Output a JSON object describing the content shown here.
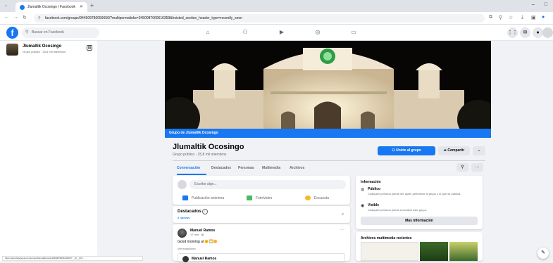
{
  "browser": {
    "tab_title": "Jlumaltik Ocosingo | Facebook",
    "url": "facebook.com/groups/944509780059650/?multipermalinks=3450087060610359&hoisted_section_header_type=recently_seen",
    "status_url": "https://www.facebook.com/groups/Jlumaltik/posts/3450087060610359/?__cft__[0]=..."
  },
  "fb": {
    "search_placeholder": "Buscar en Facebook"
  },
  "sidebar": {
    "group_name": "Jlumaltik Ocosingo",
    "group_meta": "Grupo público · 25,8 mil miembros"
  },
  "cover": {
    "label": "Grupo de Jlumaltik Ocosingo"
  },
  "group": {
    "title": "Jlumaltik Ocosingo",
    "meta": "Grupo público · 25,8 mil miembros",
    "join_label": "Unirte al grupo",
    "share_label": "Compartir",
    "more_label": "⌄",
    "tabs": [
      "Conversación",
      "Destacados",
      "Personas",
      "Multimedia",
      "Archivos"
    ]
  },
  "composer": {
    "placeholder": "Escribe algo...",
    "actions": [
      {
        "label": "Publicación anónima",
        "color": "#1877f2"
      },
      {
        "label": "Foto/video",
        "color": "#45bd62"
      },
      {
        "label": "Encuesta",
        "color": "#f7b928"
      }
    ]
  },
  "featured": {
    "title": "Destacados",
    "count": "2 nuevos"
  },
  "post": {
    "author": "Manuel Ramos",
    "time": "17 min",
    "text": "Good morning al 🌞🌅🌼",
    "translate": "Ver traducción",
    "shared_author": "Manuel Ramos"
  },
  "about": {
    "title": "Información",
    "items": [
      {
        "heading": "Público",
        "desc": "Cualquier persona puede ver quién pertenece al grupo y lo que se publica."
      },
      {
        "heading": "Visible",
        "desc": "Cualquier persona puede encontrar este grupo."
      }
    ],
    "more_info": "Más información"
  },
  "media": {
    "title": "Archivos multimedia recientes"
  },
  "colors": {
    "accent": "#1877f2",
    "page_bg": "#f0f2f5"
  }
}
